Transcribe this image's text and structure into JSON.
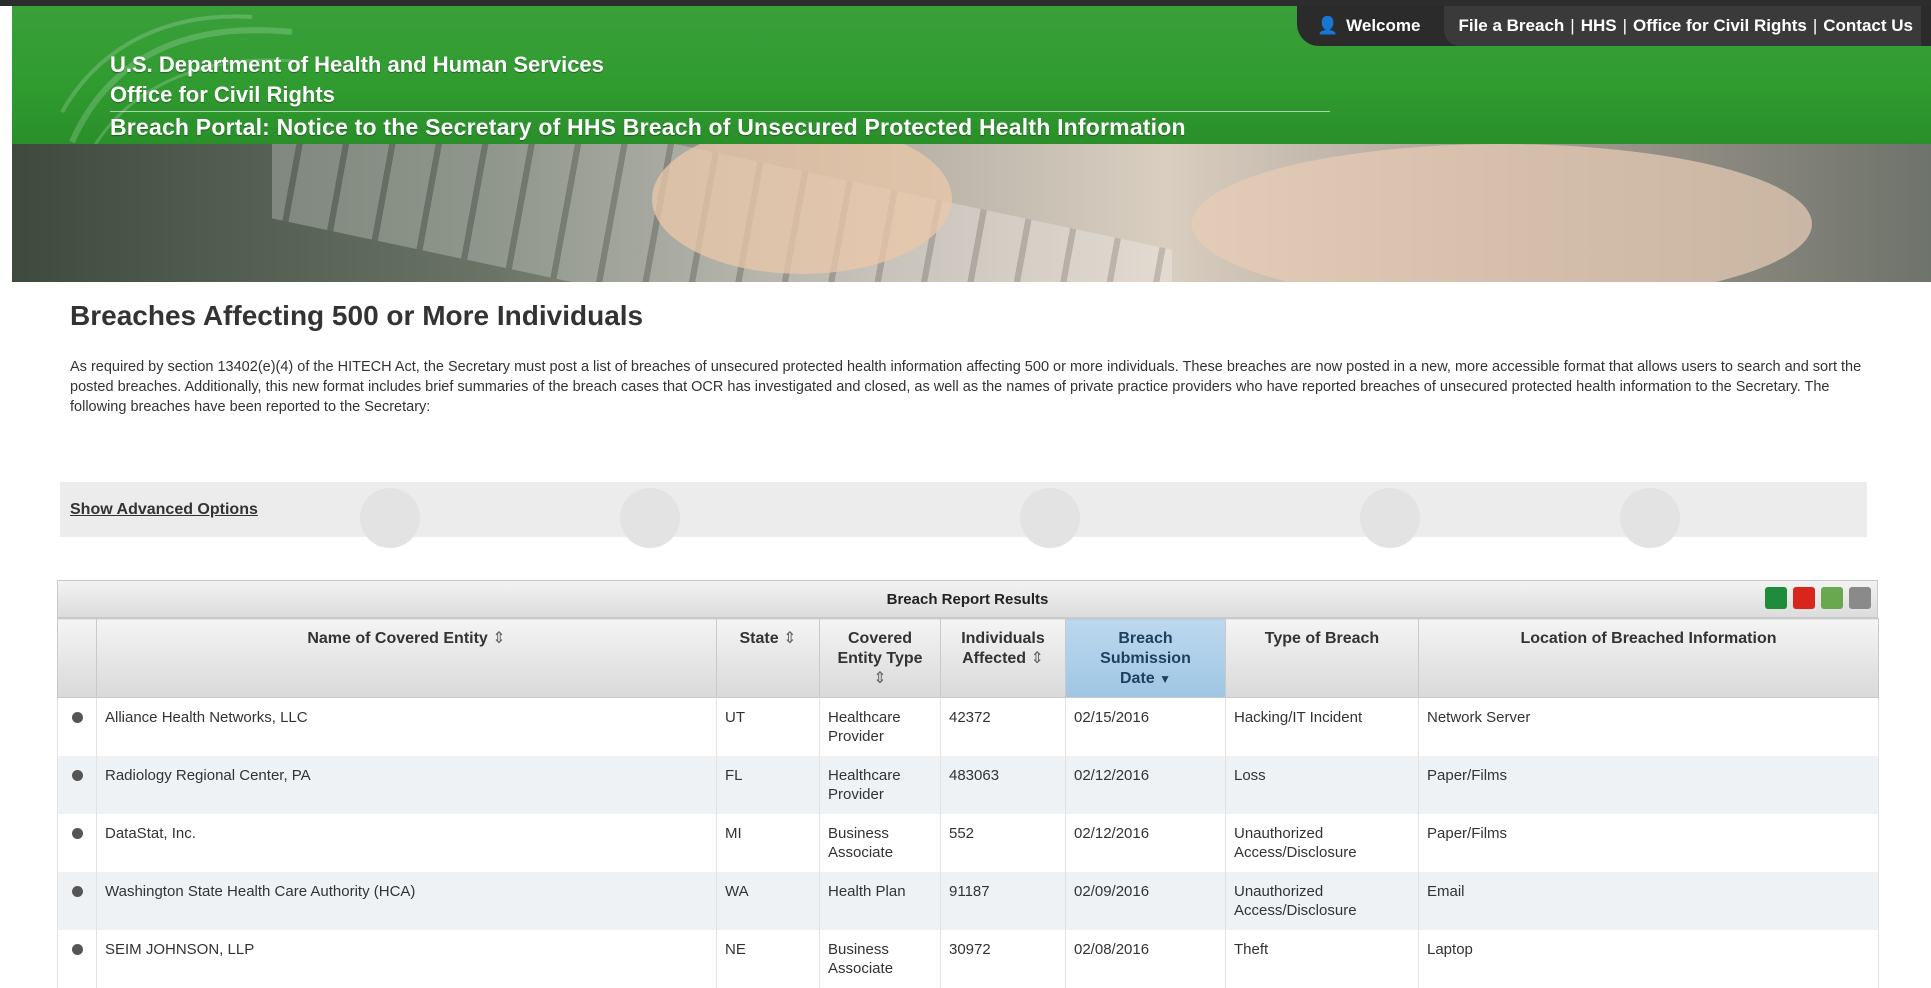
{
  "header": {
    "welcome": "Welcome",
    "links": [
      "File a Breach",
      "HHS",
      "Office for Civil Rights",
      "Contact Us"
    ],
    "dept": "U.S. Department of Health and Human Services",
    "office": "Office for Civil Rights",
    "portal": "Breach Portal: Notice to the Secretary of HHS Breach of Unsecured Protected Health Information"
  },
  "page": {
    "heading": "Breaches Affecting 500 or More Individuals",
    "intro": "As required by section 13402(e)(4) of the HITECH Act, the Secretary must post a list of breaches of unsecured protected health information affecting 500 or more individuals. These breaches are now posted in a new, more accessible format that allows users to search and sort the posted breaches. Additionally, this new format includes brief summaries of the breach cases that OCR has investigated and closed, as well as the names of private practice providers who have reported breaches of unsecured protected health information to the Secretary. The following breaches have been reported to the Secretary:",
    "advanced_options": "Show Advanced Options"
  },
  "results": {
    "title": "Breach Report Results",
    "columns": {
      "name": "Name of Covered Entity",
      "state": "State",
      "type_a": "Covered",
      "type_b": "Entity Type",
      "ind_a": "Individuals",
      "ind_b": "Affected",
      "date_a": "Breach",
      "date_b": "Submission",
      "date_c": "Date",
      "breach_type": "Type of Breach",
      "location": "Location of Breached Information"
    },
    "rows": [
      {
        "name": "Alliance Health Networks, LLC",
        "state": "UT",
        "type": "Healthcare Provider",
        "affected": "42372",
        "date": "02/15/2016",
        "breach": "Hacking/IT Incident",
        "location": "Network Server"
      },
      {
        "name": "Radiology Regional Center, PA",
        "state": "FL",
        "type": "Healthcare Provider",
        "affected": "483063",
        "date": "02/12/2016",
        "breach": "Loss",
        "location": "Paper/Films"
      },
      {
        "name": "DataStat, Inc.",
        "state": "MI",
        "type": "Business Associate",
        "affected": "552",
        "date": "02/12/2016",
        "breach": "Unauthorized Access/Disclosure",
        "location": "Paper/Films"
      },
      {
        "name": "Washington State Health Care Authority (HCA)",
        "state": "WA",
        "type": "Health Plan",
        "affected": "91187",
        "date": "02/09/2016",
        "breach": "Unauthorized Access/Disclosure",
        "location": "Email"
      },
      {
        "name": "SEIM JOHNSON, LLP",
        "state": "NE",
        "type": "Business Associate",
        "affected": "30972",
        "date": "02/08/2016",
        "breach": "Theft",
        "location": "Laptop"
      }
    ]
  }
}
